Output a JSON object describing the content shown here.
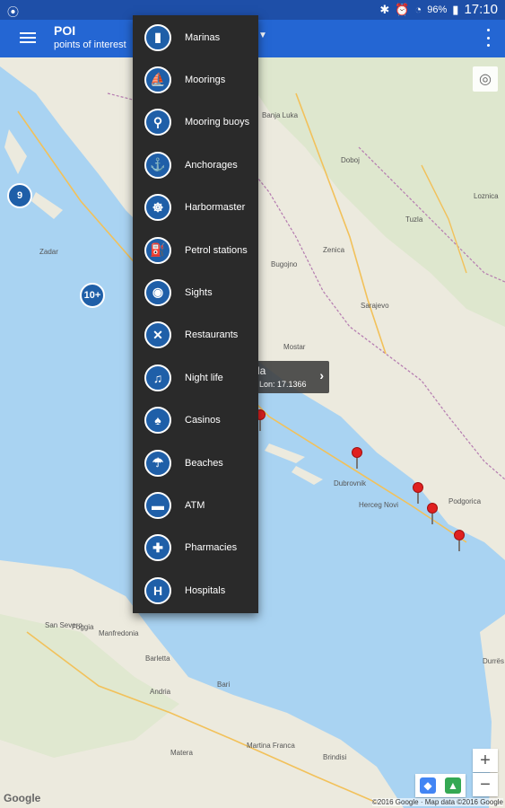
{
  "status_bar": {
    "location_icon": "location-pin-icon",
    "battery": "96%",
    "time": "17:10"
  },
  "app_bar": {
    "title": "POI",
    "subtitle": "points of interest"
  },
  "menu": {
    "items": [
      {
        "label": "Marinas",
        "icon": "marina-icon",
        "glyph": "▮"
      },
      {
        "label": "Moorings",
        "icon": "moorings-icon",
        "glyph": "⛵"
      },
      {
        "label": "Mooring buoys",
        "icon": "mooring-buoy-icon",
        "glyph": "⚲"
      },
      {
        "label": "Anchorages",
        "icon": "anchor-icon",
        "glyph": "⚓"
      },
      {
        "label": "Harbormaster",
        "icon": "ship-wheel-icon",
        "glyph": "☸"
      },
      {
        "label": "Petrol stations",
        "icon": "fuel-icon",
        "glyph": "⛽"
      },
      {
        "label": "Sights",
        "icon": "camera-icon",
        "glyph": "◉"
      },
      {
        "label": "Restaurants",
        "icon": "restaurant-icon",
        "glyph": "✕"
      },
      {
        "label": "Night life",
        "icon": "night-life-icon",
        "glyph": "♫"
      },
      {
        "label": "Casinos",
        "icon": "spade-icon",
        "glyph": "♠"
      },
      {
        "label": "Beaches",
        "icon": "palm-icon",
        "glyph": "☂"
      },
      {
        "label": "ATM",
        "icon": "atm-icon",
        "glyph": "▬"
      },
      {
        "label": "Pharmacies",
        "icon": "pharmacy-icon",
        "glyph": "✚"
      },
      {
        "label": "Hospitals",
        "icon": "hospital-icon",
        "glyph": "H"
      }
    ]
  },
  "map": {
    "clusters": [
      {
        "label": "9"
      },
      {
        "label": "10+"
      }
    ],
    "popup": {
      "line1": "la",
      "line2": "Lon: 17.1366"
    },
    "places": [
      "Zadar",
      "Sarajevo",
      "Tuzla",
      "Zenica",
      "Dubrovnik",
      "Podgorica",
      "Bari",
      "Foggia",
      "Barletta",
      "Andria",
      "Manfredonia",
      "San Severo",
      "Martina Franca",
      "Brindisi",
      "Matera",
      "Bugojno",
      "Doboj",
      "Banja Luka",
      "Mostar",
      "Herceg Novi",
      "Durrës",
      "Loznica"
    ],
    "zoom_in": "+",
    "zoom_out": "−",
    "google": "Google",
    "attribution": "©2016 Google · Map data ©2016 Google"
  },
  "colors": {
    "status_bar": "#1e4fa8",
    "app_bar": "#2466d3",
    "menu_bg": "#2a2a2a",
    "poi_blue": "#1f5fa8",
    "sea": "#a9d3f2",
    "land": "#eceade"
  }
}
